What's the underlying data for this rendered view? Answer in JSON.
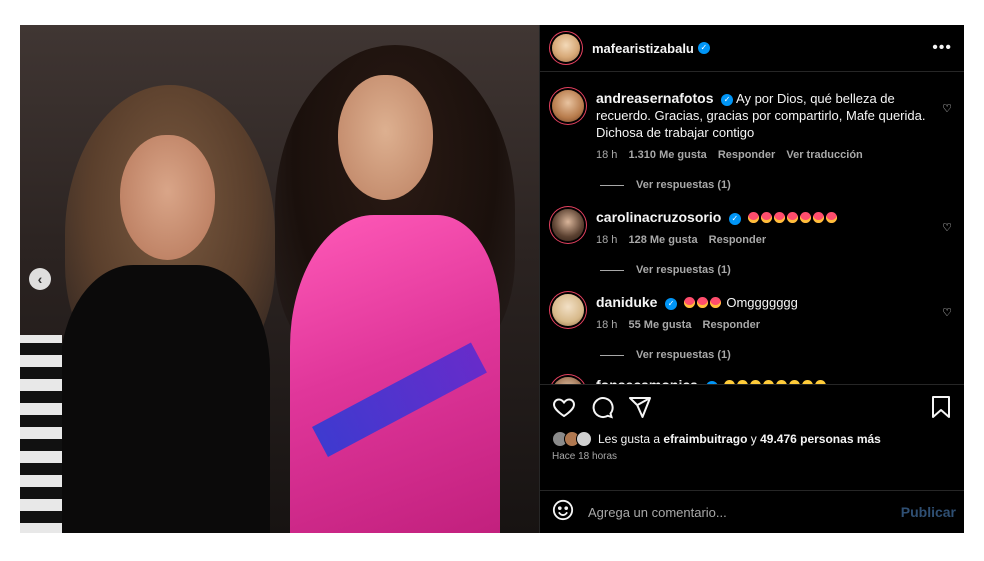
{
  "post": {
    "author": "mafearistizabalu",
    "more_label": "•••",
    "comments": [
      {
        "user": "andreasernafotos",
        "text": "Ay por Dios, qué belleza de recuerdo. Gracias, gracias por compartirlo, Mafe querida. Dichosa de trabajar contigo",
        "time": "18 h",
        "likes": "1.310 Me gusta",
        "reply": "Responder",
        "translate": "Ver traducción",
        "view_replies": "Ver respuestas (1)"
      },
      {
        "user": "carolinacruzosorio",
        "text": "",
        "time": "18 h",
        "likes": "128 Me gusta",
        "reply": "Responder",
        "view_replies": "Ver respuestas (1)"
      },
      {
        "user": "daniduke",
        "text": "Omggggggg",
        "time": "18 h",
        "likes": "55 Me gusta",
        "reply": "Responder",
        "view_replies": "Ver respuestas (1)"
      },
      {
        "user": "fonsecamonica",
        "text": ""
      }
    ],
    "likes_prefix": "Les gusta a",
    "likes_user": "efraimbuitrago",
    "likes_connector": "y",
    "likes_count": "49.476 personas más",
    "time_ago": "Hace 18 horas",
    "comment_placeholder": "Agrega un comentario...",
    "publish_label": "Publicar"
  },
  "colors": {
    "background": "#000000",
    "verified": "#0095f6",
    "muted": "#a8a8a8",
    "publish_disabled": "#2f4f73"
  }
}
